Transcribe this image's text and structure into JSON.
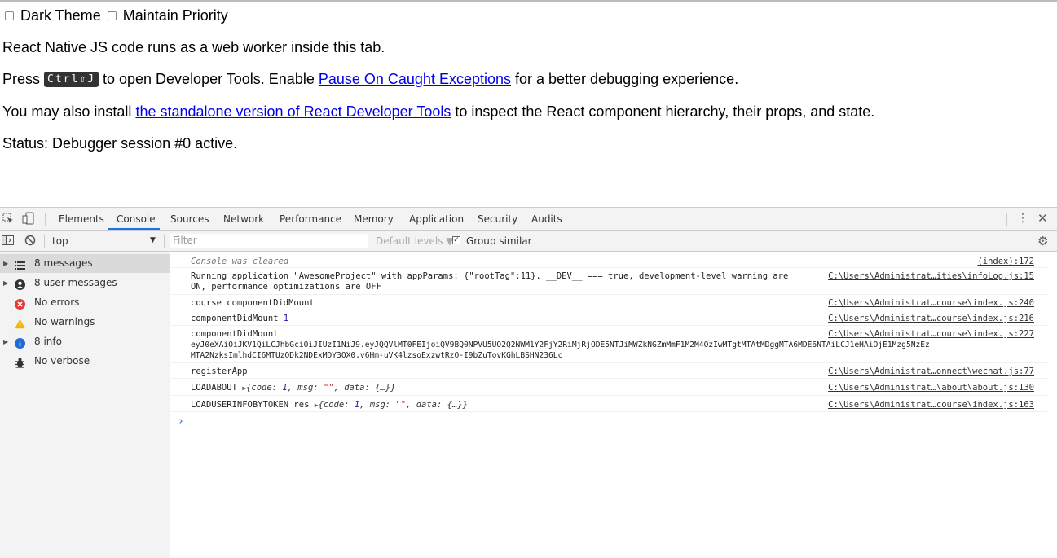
{
  "page": {
    "options": [
      {
        "label": "Dark Theme",
        "checked": false
      },
      {
        "label": "Maintain Priority",
        "checked": false
      }
    ],
    "line1": "React Native JS code runs as a web worker inside this tab.",
    "line2_pre": "Press ",
    "line2_kbd": "Ctrl⇧J",
    "line2_mid": " to open Developer Tools. Enable ",
    "line2_link": "Pause On Caught Exceptions",
    "line2_post": " for a better debugging experience.",
    "line3_pre": "You may also install ",
    "line3_link": "the standalone version of React Developer Tools",
    "line3_post": " to inspect the React component hierarchy, their props, and state.",
    "status": "Status: Debugger session #0 active."
  },
  "devtools": {
    "tabs": [
      "Elements",
      "Console",
      "Sources",
      "Network",
      "Performance",
      "Memory",
      "Application",
      "Security",
      "Audits"
    ],
    "active_tab": "Console",
    "context": "top",
    "filter_placeholder": "Filter",
    "levels": "Default levels ▼",
    "group_similar": "Group similar",
    "group_similar_checked": true,
    "sidebar": [
      {
        "label": "8 messages",
        "icon": "list-icon"
      },
      {
        "label": "8 user messages",
        "icon": "user-icon"
      },
      {
        "label": "No errors",
        "icon": "error-icon"
      },
      {
        "label": "No warnings",
        "icon": "warning-icon"
      },
      {
        "label": "8 info",
        "icon": "info-icon"
      },
      {
        "label": "No verbose",
        "icon": "bug-icon"
      }
    ],
    "messages": [
      {
        "text": "Console was cleared",
        "src": "(index):172"
      },
      {
        "text1": "Running application \"AwesomeProject\" with appParams: {\"rootTag\":11}. __DEV__ === true, development-level warning are",
        "text2": "ON, performance optimizations are OFF",
        "src": "C:\\Users\\Administrat…ities\\infoLog.js:15"
      },
      {
        "text": "course componentDidMount",
        "src": "C:\\Users\\Administrat…course\\index.js:240"
      },
      {
        "text": "componentDidMount",
        "num": "1",
        "src": "C:\\Users\\Administrat…course\\index.js:216"
      },
      {
        "text1": "componentDidMount",
        "text2": "eyJ0eXAiOiJKV1QiLCJhbGciOiJIUzI1NiJ9.eyJQQVlMT0FEIjoiQV9BQ0NPVU5UO2Q2NWM1Y2FjY2RiMjRjODE5NTJiMWZkNGZmMmF1M2M4OzIwMTgtMTAtMDggMTA6MDE6NTAiLCJ1eHAiOjE1Mzg5NzEz",
        "text3": "MTA2NzksImlhdCI6MTUzODk2NDExMDY3OX0.v6Hm-uVK4lzsoExzwtRzO-I9bZuTovKGhLBSHN236Lc",
        "src": "C:\\Users\\Administrat…course\\index.js:227"
      },
      {
        "text": "registerApp",
        "src": "C:\\Users\\Administrat…onnect\\wechat.js:77"
      },
      {
        "text": "LOADABOUT",
        "obj_pre": "{code: ",
        "obj_num": "1",
        "obj_mid": ", msg: ",
        "obj_str": "\"\"",
        "obj_post": ", data: {…}}",
        "src": "C:\\Users\\Administrat…\\about\\about.js:130"
      },
      {
        "text": "LOADUSERINFOBYTOKEN res",
        "obj_pre": "{code: ",
        "obj_num": "1",
        "obj_mid": ", msg: ",
        "obj_str": "\"\"",
        "obj_post": ", data: {…}}",
        "src": "C:\\Users\\Administrat…course\\index.js:163"
      }
    ],
    "prompt": "›"
  }
}
